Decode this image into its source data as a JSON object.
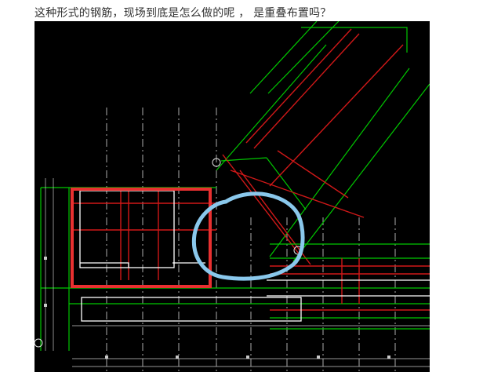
{
  "post": {
    "question": "这种形式的钢筋，现场到底是怎么做的呢 ，  是重叠布置吗？"
  },
  "drawing": {
    "background": "#000000",
    "colors": {
      "outline": "#00c800",
      "rebar": "#d01818",
      "dimension": "#c8c8c8",
      "axis": "#e0e0e0",
      "column": "#ffffff",
      "annotation_box": "#e83030",
      "annotation_circle": "#8ac8ec"
    },
    "annotations": [
      {
        "kind": "rectangle",
        "color": "#e83030"
      },
      {
        "kind": "freehand-circle",
        "color": "#8ac8ec"
      }
    ]
  }
}
